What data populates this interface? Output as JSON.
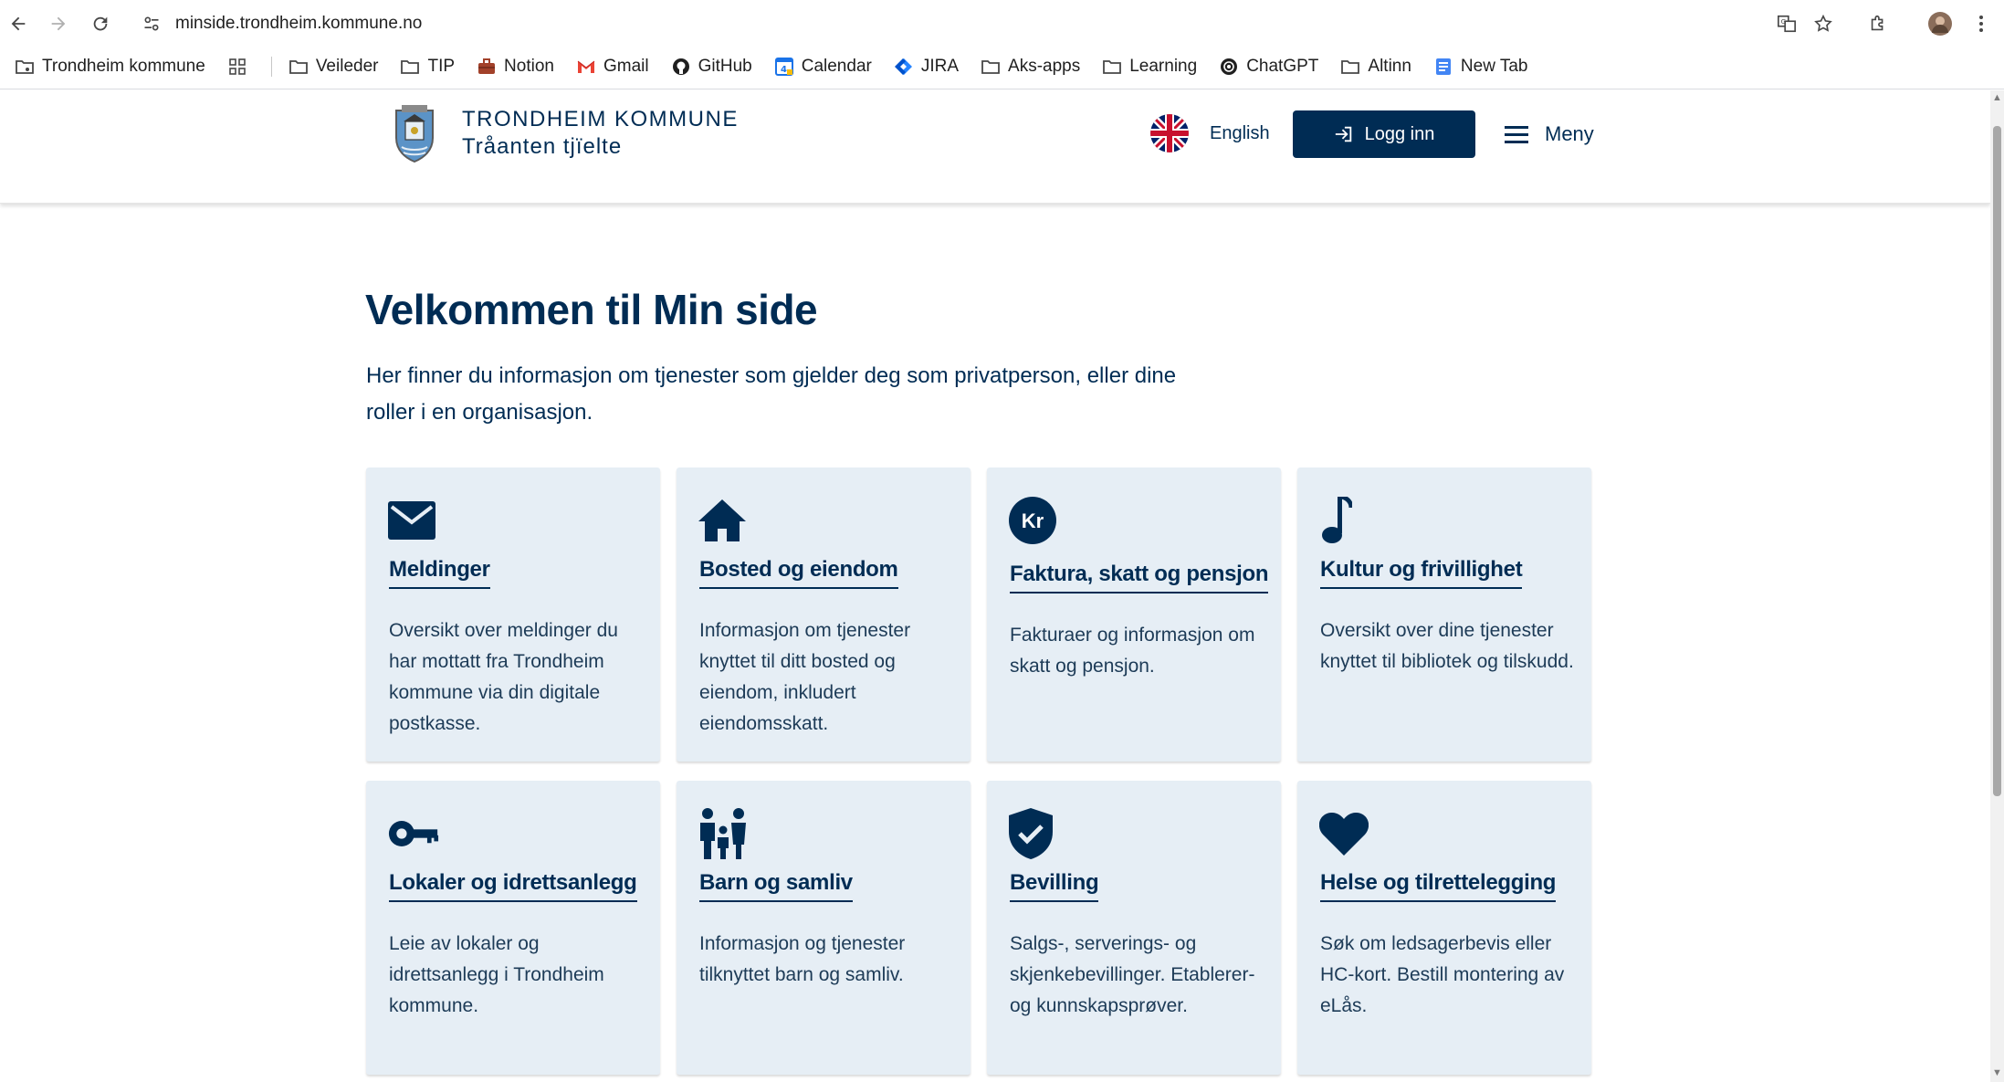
{
  "browser": {
    "url": "minside.trondheim.kommune.no",
    "bookmarks": [
      {
        "label": "Trondheim kommune",
        "icon": "folder-link-icon"
      },
      {
        "label": "Veileder",
        "icon": "folder-icon"
      },
      {
        "label": "TIP",
        "icon": "folder-icon"
      },
      {
        "label": "Notion",
        "icon": "briefcase-icon"
      },
      {
        "label": "Gmail",
        "icon": "gmail-icon"
      },
      {
        "label": "GitHub",
        "icon": "github-icon"
      },
      {
        "label": "Calendar",
        "icon": "calendar-icon"
      },
      {
        "label": "JIRA",
        "icon": "jira-icon"
      },
      {
        "label": "Aks-apps",
        "icon": "folder-icon"
      },
      {
        "label": "Learning",
        "icon": "folder-icon"
      },
      {
        "label": "ChatGPT",
        "icon": "chatgpt-icon"
      },
      {
        "label": "Altinn",
        "icon": "folder-icon"
      },
      {
        "label": "New Tab",
        "icon": "newtab-icon"
      }
    ]
  },
  "header": {
    "org_name": "TRONDHEIM KOMMUNE",
    "org_sub": "Tråanten tjïelte",
    "language": "English",
    "login": "Logg inn",
    "menu": "Meny"
  },
  "main": {
    "title": "Velkommen til Min side",
    "intro": "Her finner du informasjon om tjenester som gjelder deg som privatperson, eller dine roller i en organisasjon.",
    "cards": [
      {
        "title": "Meldinger",
        "desc": "Oversikt over meldinger du har mottatt fra Trondheim kommune via din digitale postkasse.",
        "icon": "envelope-icon"
      },
      {
        "title": "Bosted og eiendom",
        "desc": "Informasjon om tjenester knyttet til ditt bosted og eiendom, inkludert eiendomsskatt.",
        "icon": "house-icon"
      },
      {
        "title": "Faktura, skatt og pensjon",
        "desc": "Fakturaer og informasjon om skatt og pensjon.",
        "icon": "kr-coin-icon"
      },
      {
        "title": "Kultur og frivillighet",
        "desc": "Oversikt over dine tjenester knyttet til bibliotek og tilskudd.",
        "icon": "music-note-icon"
      },
      {
        "title": "Lokaler og idrettsanlegg",
        "desc": "Leie av lokaler og idrettsanlegg i Trondheim kommune.",
        "icon": "key-icon"
      },
      {
        "title": "Barn og samliv",
        "desc": "Informasjon og tjenester tilknyttet barn og samliv.",
        "icon": "family-icon"
      },
      {
        "title": "Bevilling",
        "desc": "Salgs-, serverings- og skjenkebevillinger. Etablerer- og kunnskapsprøver.",
        "icon": "shield-check-icon"
      },
      {
        "title": "Helse og tilrettelegging",
        "desc": "Søk om ledsagerbevis eller HC-kort. Bestill montering av eLås.",
        "icon": "heart-icon"
      }
    ]
  },
  "colors": {
    "primary": "#002c54",
    "card_bg": "#e6eef5"
  }
}
